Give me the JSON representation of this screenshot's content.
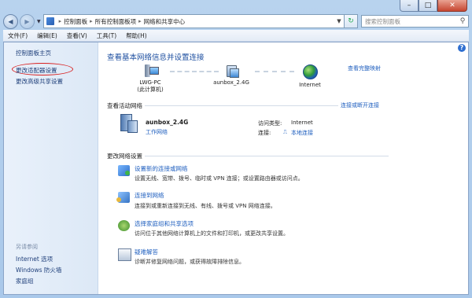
{
  "window": {
    "caption": {
      "minimize": "–",
      "maximize": "□",
      "close": "✕"
    }
  },
  "address": {
    "breadcrumbs": [
      "控制面板",
      "所有控制面板项",
      "网络和共享中心"
    ],
    "search_placeholder": "搜索控制面板"
  },
  "menu": [
    "文件(F)",
    "编辑(E)",
    "查看(V)",
    "工具(T)",
    "帮助(H)"
  ],
  "sidebar": {
    "home": "控制面板主页",
    "items": [
      "更改适配器设置",
      "更改高级共享设置"
    ],
    "see_also_title": "另请参阅",
    "see_also": [
      "Internet 选项",
      "Windows 防火墙",
      "家庭组"
    ]
  },
  "main": {
    "heading": "查看基本网络信息并设置连接",
    "view_full_map": "查看完整映射",
    "map": {
      "pc_name": "LWG-PC",
      "pc_sub": "(此计算机)",
      "router_name": "aunbox_2.4G",
      "internet_name": "Internet"
    },
    "active": {
      "title": "查看活动网络",
      "connect_disconnect": "连接或断开连接",
      "network_name": "aunbox_2.4G",
      "network_type": "工作网络",
      "access_type_label": "访问类型:",
      "access_type_value": "Internet",
      "connections_label": "连接:",
      "connections_value": "本地连接"
    },
    "change_title": "更改网络设置",
    "tasks": [
      {
        "title": "设置新的连接或网络",
        "desc": "设置无线、宽带、拨号、临时或 VPN 连接；或设置路由器或访问点。"
      },
      {
        "title": "连接到网络",
        "desc": "连接到或重新连接到无线、有线、拨号或 VPN 网络连接。"
      },
      {
        "title": "选择家庭组和共享选项",
        "desc": "访问位于其他网络计算机上的文件和打印机，或更改共享设置。"
      },
      {
        "title": "疑难解答",
        "desc": "诊断并修复网络问题，或获得故障排除信息。"
      }
    ]
  }
}
